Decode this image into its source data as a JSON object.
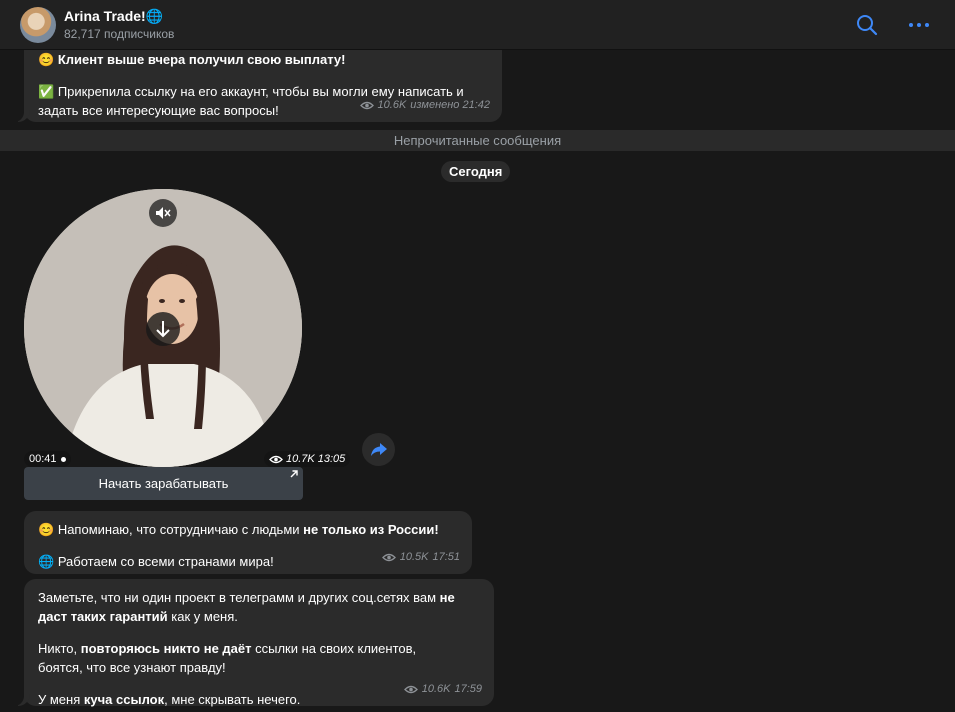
{
  "header": {
    "title": "Arina Trade!🌐",
    "subscribers": "82,717 подписчиков",
    "search_icon": "search-icon",
    "more_icon": "more-icon"
  },
  "messages": {
    "m1": {
      "line1": "Клиент выше вчера получил свою выплату!",
      "line1_emoji": "😊",
      "line2_emoji": "✅",
      "line2": "Прикрепила ссылку на его аккаунт, чтобы вы могли ему написать и",
      "line3": "задать все интересующие вас вопросы!",
      "views": "10.6K",
      "meta": "изменено 21:42"
    },
    "unread": "Непрочитанные сообщения",
    "date": "Сегодня",
    "video": {
      "duration": "00:41",
      "views": "10.7K",
      "time": "13:05",
      "button": "Начать зарабатывать"
    },
    "m2": {
      "emoji1": "😊",
      "text1": "Напоминаю, что сотрудничаю с людьми ",
      "bold1": "не только из России!",
      "emoji2": "🌐",
      "text2": "Работаем со всеми странами мира!",
      "views": "10.5K",
      "time": "17:51"
    },
    "m3": {
      "p1a": "Заметьте, что ни один проект в телеграмм и других соц.сетях вам ",
      "p1b": "не",
      "p1c": "даст таких гарантий",
      "p1d": " как у меня.",
      "p2a": "Никто, ",
      "p2b": "повторяюсь никто не даёт",
      "p2c": " ссылки на своих клиентов,",
      "p2d": "боятся, что все узнают правду!",
      "p3a": "У меня ",
      "p3b": "куча ссылок",
      "p3c": ", мне скрывать нечего.",
      "views": "10.6K",
      "time": "17:59"
    }
  },
  "colors": {
    "background": "#181818",
    "bubble": "#2b2b2b",
    "accent": "#3e88f7"
  }
}
